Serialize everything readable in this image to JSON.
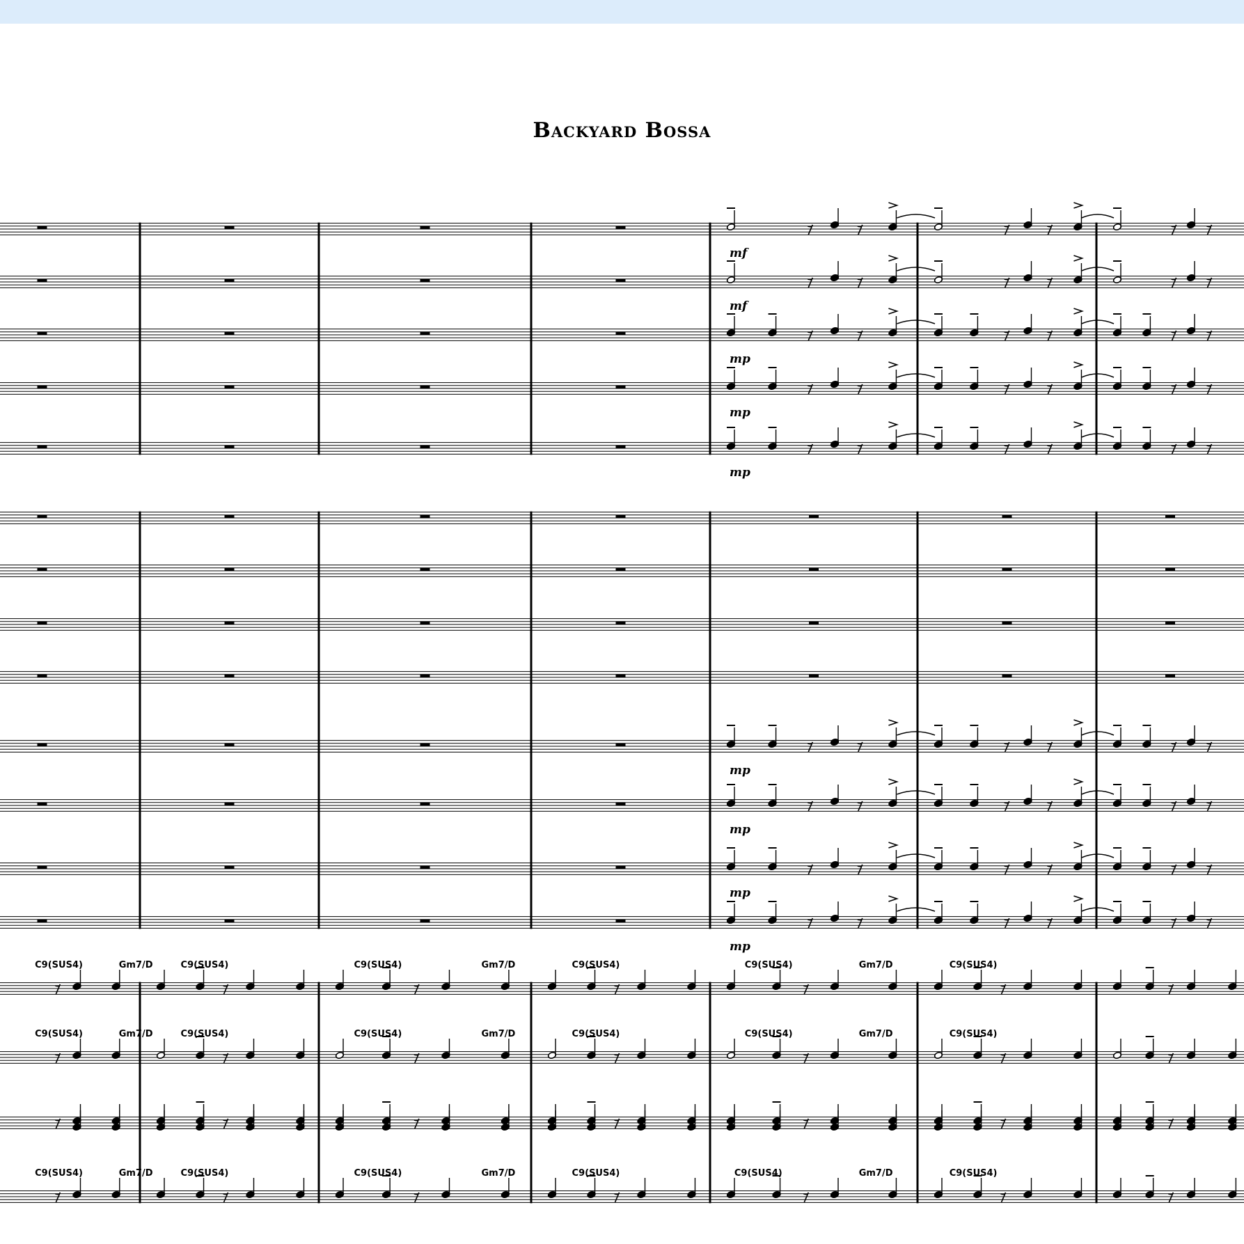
{
  "app": {
    "accent": "#dcecfb"
  },
  "score": {
    "title": "Backyard Bossa",
    "dynamics": [
      {
        "staff": 0,
        "measure": 4,
        "text": "mf"
      },
      {
        "staff": 1,
        "measure": 4,
        "text": "mf"
      },
      {
        "staff": 2,
        "measure": 4,
        "text": "mp"
      },
      {
        "staff": 3,
        "measure": 4,
        "text": "mp"
      },
      {
        "staff": 4,
        "measure": 4,
        "text": "mp"
      },
      {
        "staff": 9,
        "measure": 4,
        "text": "mp"
      },
      {
        "staff": 10,
        "measure": 4,
        "text": "mp"
      },
      {
        "staff": 11,
        "measure": 4,
        "text": "mp"
      },
      {
        "staff": 12,
        "measure": 4,
        "text": "mp"
      }
    ],
    "chord_rows": [
      [
        {
          "measure": 0,
          "pos": 0.15,
          "text": "C9(SUS4)"
        },
        {
          "measure": 0,
          "pos": 0.75,
          "text": "Gm7/D"
        },
        {
          "measure": 1,
          "pos": 0.15,
          "text": "C9(SUS4)"
        },
        {
          "measure": 2,
          "pos": 0.1,
          "text": "C9(SUS4)"
        },
        {
          "measure": 2,
          "pos": 0.7,
          "text": "Gm7/D"
        },
        {
          "measure": 3,
          "pos": 0.15,
          "text": "C9(SUS4)"
        },
        {
          "measure": 4,
          "pos": 0.1,
          "text": "C9(SUS4)"
        },
        {
          "measure": 4,
          "pos": 0.65,
          "text": "Gm7/D"
        },
        {
          "measure": 5,
          "pos": 0.1,
          "text": "C9(SUS4)"
        }
      ],
      [
        {
          "measure": 0,
          "pos": 0.15,
          "text": "C9(SUS4)"
        },
        {
          "measure": 0,
          "pos": 0.75,
          "text": "Gm7/D"
        },
        {
          "measure": 1,
          "pos": 0.15,
          "text": "C9(SUS4)"
        },
        {
          "measure": 2,
          "pos": 0.1,
          "text": "C9(SUS4)"
        },
        {
          "measure": 2,
          "pos": 0.7,
          "text": "Gm7/D"
        },
        {
          "measure": 3,
          "pos": 0.15,
          "text": "C9(SUS4)"
        },
        {
          "measure": 4,
          "pos": 0.1,
          "text": "C9(SUS4)"
        },
        {
          "measure": 4,
          "pos": 0.65,
          "text": "Gm7/D"
        },
        {
          "measure": 5,
          "pos": 0.1,
          "text": "C9(SUS4)"
        }
      ],
      [
        {
          "measure": 0,
          "pos": 0.15,
          "text": "C9(SUS4)"
        },
        {
          "measure": 0,
          "pos": 0.75,
          "text": "Gm7/D"
        },
        {
          "measure": 1,
          "pos": 0.15,
          "text": "C9(SUS4)"
        },
        {
          "measure": 2,
          "pos": 0.1,
          "text": "C9(SUS4)"
        },
        {
          "measure": 2,
          "pos": 0.7,
          "text": "Gm7/D"
        },
        {
          "measure": 3,
          "pos": 0.15,
          "text": "C9(SUS4)"
        },
        {
          "measure": 4,
          "pos": 0.05,
          "text": "C9(SUS4)"
        },
        {
          "measure": 4,
          "pos": 0.65,
          "text": "Gm7/D"
        },
        {
          "measure": 5,
          "pos": 0.1,
          "text": "C9(SUS4)"
        }
      ]
    ]
  }
}
